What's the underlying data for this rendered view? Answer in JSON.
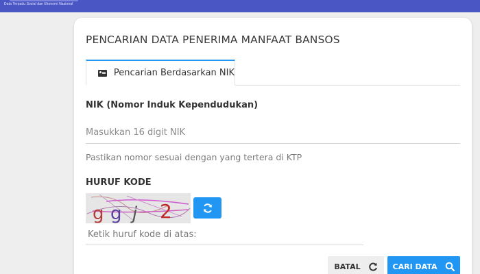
{
  "header": {
    "logo_subtitle": "Data Terpadu Sosial dan Ekonomi Nasional"
  },
  "card": {
    "title": "PENCARIAN DATA PENERIMA MANFAAT BANSOS"
  },
  "tabs": [
    {
      "label": "Pencarian Berdasarkan NIK",
      "icon": "id-card-icon",
      "active": true
    }
  ],
  "nik": {
    "label": "NIK (Nomor Induk Kependudukan)",
    "placeholder": "Masukkan 16 digit NIK",
    "value": "",
    "help": "Pastikan nomor sesuai dengan yang tertera di KTP"
  },
  "captcha": {
    "label": "HURUF KODE",
    "code": "ggj2",
    "placeholder": "Ketik huruf kode di atas:",
    "value": "",
    "refresh_icon": "refresh-icon"
  },
  "actions": {
    "cancel_label": "BATAL",
    "cancel_icon": "reset-icon",
    "search_label": "CARI DATA",
    "search_icon": "search-icon"
  },
  "colors": {
    "header": "#4a56c4",
    "primary": "#2196f3",
    "background": "#eeeeee"
  }
}
